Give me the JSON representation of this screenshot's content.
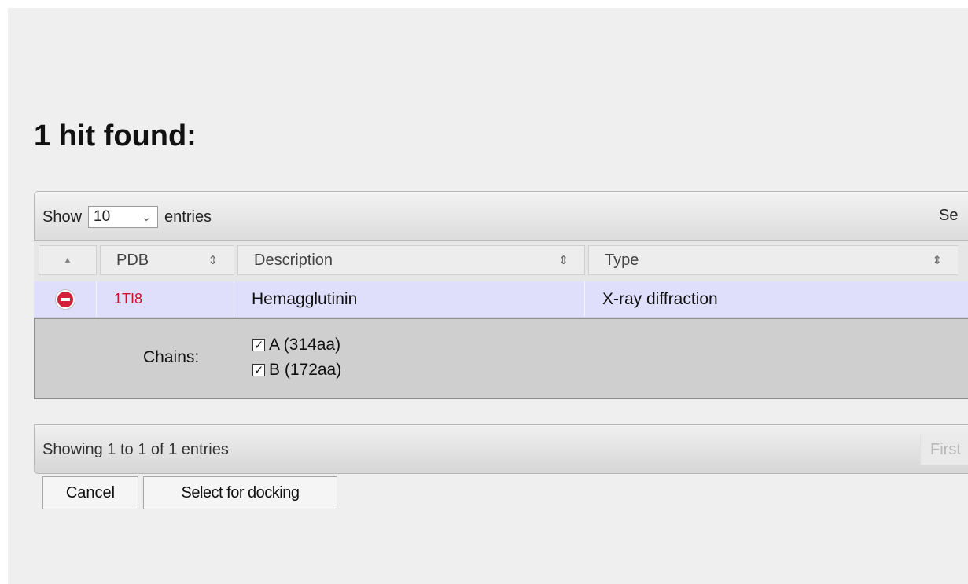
{
  "heading": "1 hit found:",
  "toolbar": {
    "show_label": "Show",
    "page_length_value": "10",
    "entries_label": "entries",
    "search_label": "Se"
  },
  "columns": {
    "pdb": "PDB",
    "description": "Description",
    "type": "Type"
  },
  "rows": [
    {
      "pdb": "1TI8",
      "description": "Hemagglutinin",
      "type": "X-ray diffraction",
      "chains_label": "Chains:",
      "chains": [
        {
          "label": "A (314aa)",
          "checked": true
        },
        {
          "label": "B (172aa)",
          "checked": true
        }
      ]
    }
  ],
  "footer": {
    "info": "Showing 1 to 1 of 1 entries",
    "first_label": "First"
  },
  "buttons": {
    "cancel": "Cancel",
    "select": "Select for docking"
  },
  "colors": {
    "pdb_link": "#d0112b",
    "row_highlight": "#dfdffc",
    "remove_icon": "#d3203a"
  }
}
